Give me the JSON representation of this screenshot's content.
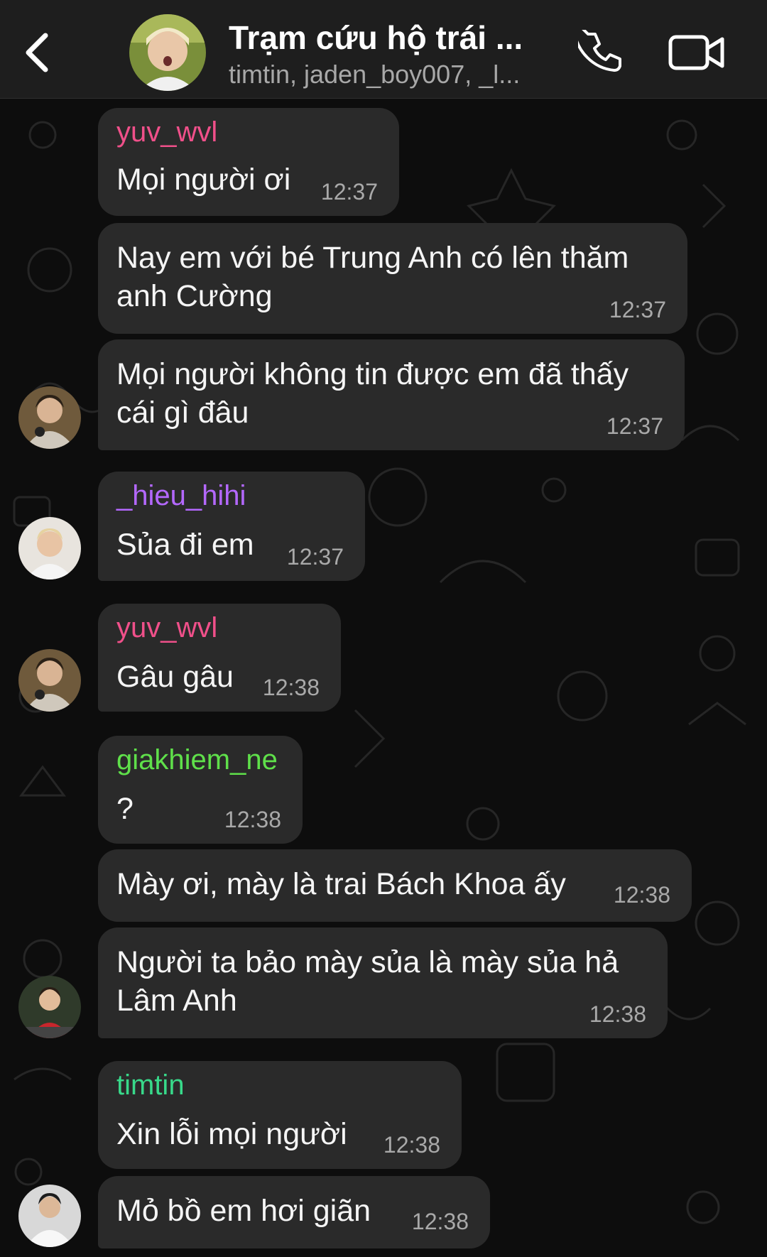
{
  "header": {
    "title": "Trạm cứu hộ trái ...",
    "members": "timtin, jaden_boy007, _l..."
  },
  "colors": {
    "sender_yuv": "#f0508a",
    "sender_hieu": "#b468ff",
    "sender_giakhiem": "#5fe04a",
    "sender_timtin": "#38d98a"
  },
  "messages": [
    {
      "sender": "yuv_wvl",
      "text": "Mọi người ơi",
      "time": "12:37"
    },
    {
      "text": "Nay em với bé Trung Anh có lên thăm\nanh Cường",
      "time": "12:37"
    },
    {
      "text": "Mọi người không tin được em đã thấy\ncái gì đâu",
      "time": "12:37"
    },
    {
      "sender": "_hieu_hihi",
      "text": "Sủa đi em",
      "time": "12:37"
    },
    {
      "sender": "yuv_wvl",
      "text": "Gâu gâu",
      "time": "12:38"
    },
    {
      "sender": "giakhiem_ne",
      "text": "?",
      "time": "12:38"
    },
    {
      "text": "Mày ơi, mày là trai Bách Khoa ấy",
      "time": "12:38"
    },
    {
      "text": "Người ta bảo mày sủa là mày sủa hả\nLâm Anh",
      "time": "12:38"
    },
    {
      "sender": "timtin",
      "text": "Xin lỗi mọi người",
      "time": "12:38"
    },
    {
      "text": "Mỏ bồ em hơi giãn",
      "time": "12:38"
    }
  ]
}
